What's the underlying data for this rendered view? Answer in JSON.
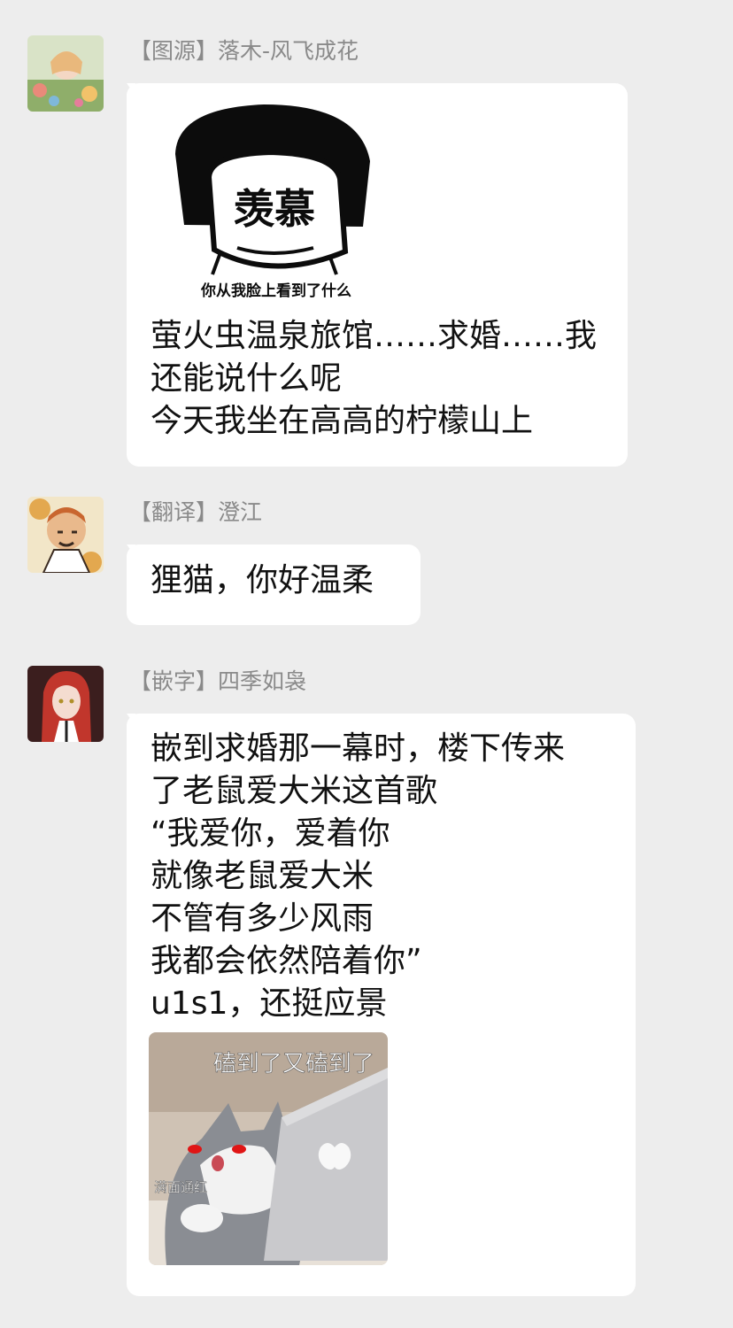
{
  "messages": [
    {
      "tag": "【图源】",
      "name": "落木-风飞成花",
      "sticker": {
        "label": "羡慕",
        "caption": "你从我脸上看到了什么"
      },
      "lines": [
        "萤火虫温泉旅馆……求婚……我",
        "还能说什么呢",
        "今天我坐在高高的柠檬山上"
      ]
    },
    {
      "tag": "【翻译】",
      "name": "澄江",
      "lines": [
        "狸猫，你好温柔"
      ]
    },
    {
      "tag": "【嵌字】",
      "name": "四季如袅",
      "lines": [
        "嵌到求婚那一幕时，楼下传来",
        "了老鼠爱大米这首歌",
        "“我爱你，爱着你",
        "就像老鼠爱大米",
        "不管有多少风雨",
        "我都会依然陪着你”",
        "u1s1，还挺应景"
      ],
      "photo": {
        "caption": "磕到了又磕到了",
        "side_caption": "满面通红"
      }
    }
  ],
  "colors": {
    "background": "#ededed",
    "bubble": "#ffffff",
    "sender_name": "#8a8a8a",
    "text": "#111111"
  }
}
